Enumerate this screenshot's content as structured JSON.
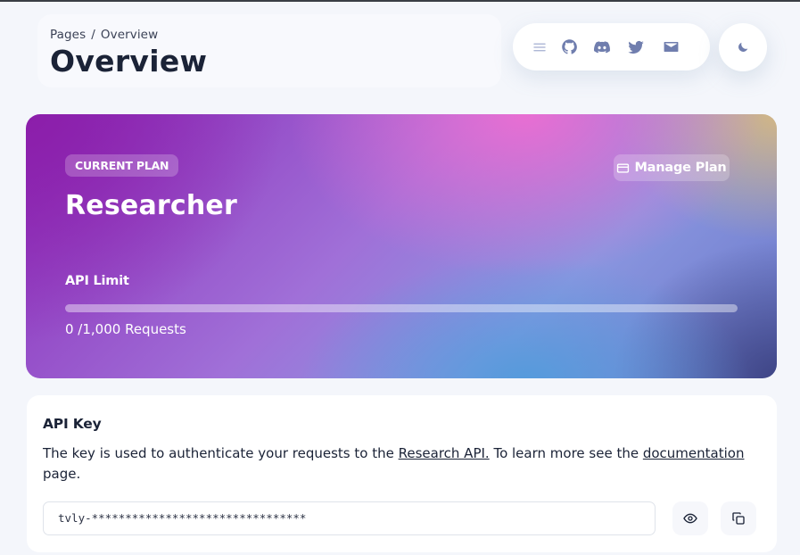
{
  "breadcrumb": {
    "parent": "Pages",
    "separator": "/",
    "current": "Overview"
  },
  "page": {
    "title": "Overview"
  },
  "nav_icons": [
    "menu-icon",
    "github-icon",
    "discord-icon",
    "twitter-icon",
    "mail-icon"
  ],
  "theme_toggle": {
    "icon": "moon-icon"
  },
  "plan": {
    "badge": "CURRENT PLAN",
    "name": "Researcher",
    "manage_label": "Manage Plan",
    "manage_icon": "credit-card-icon",
    "limit_label": "API Limit",
    "requests_text": "0 /1,000 Requests",
    "used": 0,
    "limit": 1000
  },
  "api_key": {
    "title": "API Key",
    "desc_before": "The key is used to authenticate your requests to the ",
    "research_link": "Research API.",
    "desc_middle": " To learn more see the ",
    "docs_link": "documentation",
    "desc_after": " page.",
    "value": "tvly-********************************",
    "reveal_icon": "eye-icon",
    "copy_icon": "copy-icon"
  },
  "colors": {
    "text_primary": "#1b2337",
    "icon_color": "#707eae",
    "card_bg": "#ffffff",
    "page_bg": "#f4f6fb"
  }
}
